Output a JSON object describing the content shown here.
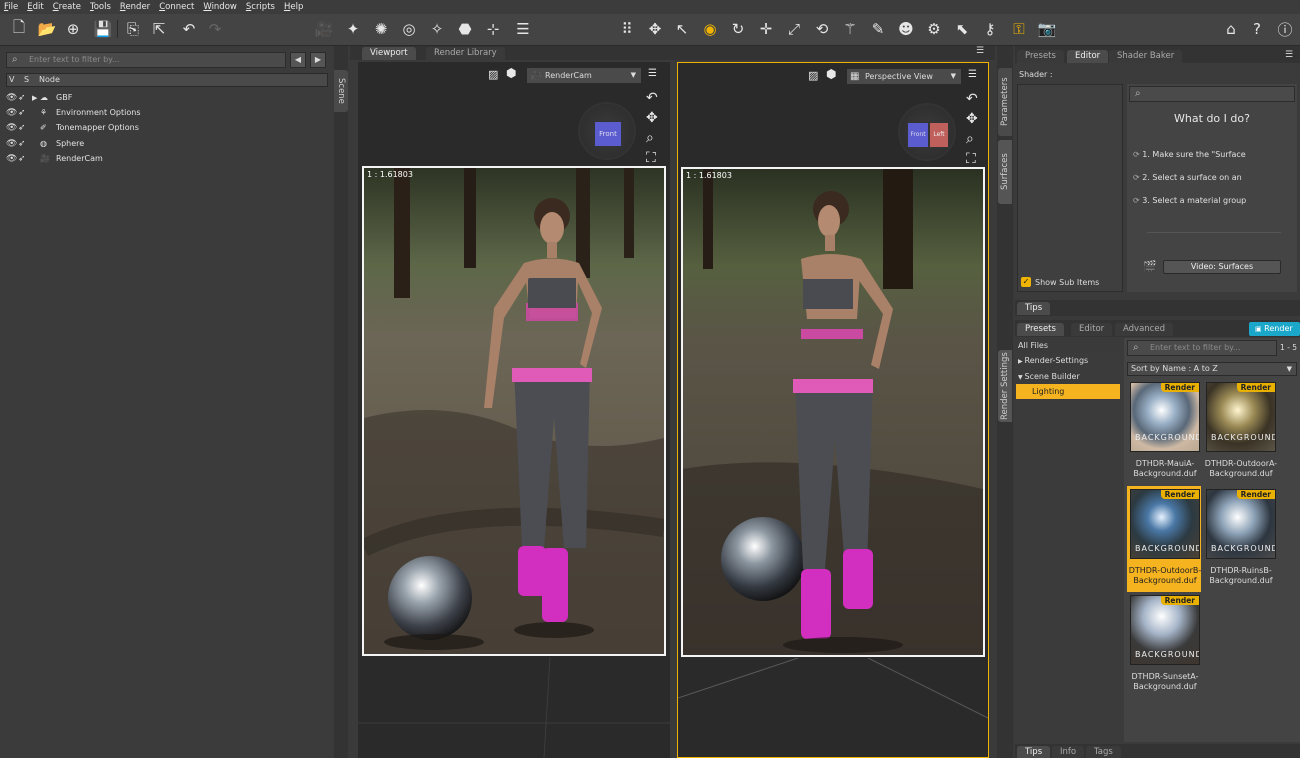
{
  "menu": [
    "File",
    "Edit",
    "Create",
    "Tools",
    "Render",
    "Connect",
    "Window",
    "Scripts",
    "Help"
  ],
  "toolbar": {
    "icons": [
      "new-file-icon",
      "open-file-icon",
      "merge-icon",
      "save-icon",
      "import-icon",
      "export-icon",
      "undo-icon",
      "redo-icon",
      "align-icon",
      "create-camera-icon",
      "create-spotlight-icon",
      "create-point-light-icon",
      "create-distant-light-icon",
      "create-linear-light-icon",
      "create-primitive-icon",
      "create-null-icon",
      "joint-editor-icon",
      "grid-icon",
      "universal-tool-icon",
      "pointer-icon",
      "node-selection-icon",
      "rotate-icon",
      "translate-icon",
      "scale-icon",
      "transform-icon",
      "active-pose-icon",
      "geometry-editor-icon",
      "surface-selection-icon",
      "figure-setup-icon",
      "render-settings-icon",
      "spot-render-icon",
      "render-icon",
      "iray-render-icon",
      "camera-snapshot-icon",
      "daz-store-icon",
      "help-icon",
      "whats-this-icon"
    ]
  },
  "scene": {
    "filter_placeholder": "Enter text to filter by...",
    "col_v": "V",
    "col_s": "S",
    "col_node": "Node",
    "tab_label": "Scene",
    "nodes": [
      "GBF",
      "Environment Options",
      "Tonemapper Options",
      "Sphere",
      "RenderCam"
    ]
  },
  "viewport": {
    "tabs": [
      "Viewport",
      "Render Library"
    ],
    "left_camera": "RenderCam",
    "right_camera": "Perspective View",
    "left_cube_label": "Front",
    "right_cube_labels": [
      "Front",
      "Left"
    ],
    "ratio_left": "1 : 1.61803",
    "ratio_right": "1 : 1.61803"
  },
  "surfaces": {
    "vtabs": [
      "Parameters",
      "Surfaces"
    ],
    "tabs": [
      "Presets",
      "Editor",
      "Shader Baker"
    ],
    "shader_label": "Shader :",
    "help_title": "What do I do?",
    "steps": [
      "1. Make sure the \"Surface",
      "2. Select a surface on an",
      "3. Select a material group"
    ],
    "video_button": "Video: Surfaces",
    "show_sub_items": "Show Sub Items",
    "tips_tab": "Tips"
  },
  "render_settings": {
    "vtab": "Render Settings",
    "tabs": [
      "Presets",
      "Editor",
      "Advanced"
    ],
    "render_button": "Render",
    "categories": [
      "All Files",
      "Render-Settings",
      "Scene Builder",
      "Lighting"
    ],
    "filter_placeholder": "Enter text to filter by...",
    "count": "1 - 5",
    "sort": "Sort by Name : A to Z",
    "badge": "Render",
    "items": [
      {
        "name": "DTHDR-MauiA-Background.duf",
        "selected": false
      },
      {
        "name": "DTHDR-OutdoorA-Background.duf",
        "selected": false
      },
      {
        "name": "DTHDR-OutdoorB-Background.duf",
        "selected": true
      },
      {
        "name": "DTHDR-RuinsB-Background.duf",
        "selected": false
      },
      {
        "name": "DTHDR-SunsetA-Background.duf",
        "selected": false
      }
    ],
    "thumb_text": "BACKGROUND",
    "bottom_tabs": [
      "Tips",
      "Info",
      "Tags"
    ]
  },
  "colors": {
    "accent": "#f0b400",
    "panel": "#3b3b3b",
    "selected": "#f5b31f",
    "render_blue": "#1aa7c9"
  }
}
